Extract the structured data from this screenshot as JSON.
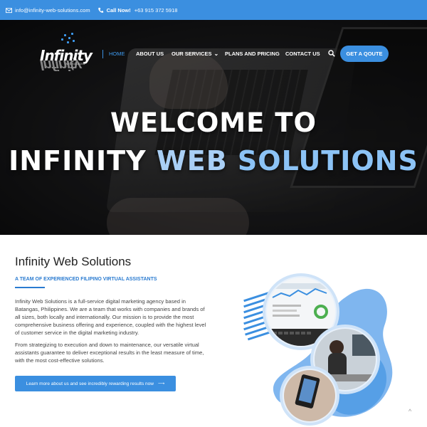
{
  "topbar": {
    "email": "info@infinity-web-solutions.com",
    "call_label": "Call Now!",
    "phone": "+63 915 372 5918"
  },
  "logo": {
    "text": "Infinity",
    "subtext": "web solutions"
  },
  "nav": {
    "items": [
      "HOME",
      "ABOUT US",
      "OUR SERVICES",
      "PLANS AND PRICING",
      "CONTACT US"
    ],
    "quote_button": "GET A QOUTE"
  },
  "hero": {
    "line1": "WELCOME TO",
    "brand_a": "INFINITY",
    "brand_b": "WEB",
    "brand_c": "SOLUTIONS"
  },
  "about": {
    "title": "Infinity Web Solutions",
    "subtitle": "A TEAM OF EXPERIENCED FILIPINO VIRTUAL ASSISTANTS",
    "paragraph1": "Infinity Web Solutions is a full-service digital marketing agency based in Batangas, Philippines. We are a team that works with companies and brands of all sizes, both locally and internationally. Our mission is to provide the most comprehensive business offering and experience, coupled with the highest level of customer service in the digital marketing industry.",
    "paragraph2": "From strategizing to execution and down to maintenance, our versatile virtual assistants guarantee to deliver exceptional results in the least measure of time, with the most cost-effective solutions.",
    "button": "Learn more about us and see incredibly rewarding results now",
    "button_arrow": "⟶"
  },
  "icons": {
    "email": "mail-icon",
    "phone": "phone-icon",
    "search": "search-icon",
    "back_to_top": "chevron-up-icon"
  },
  "colors": {
    "accent": "#3b8fe0",
    "link_active": "#3e9bf0",
    "subtitle": "#2a7bd0"
  }
}
